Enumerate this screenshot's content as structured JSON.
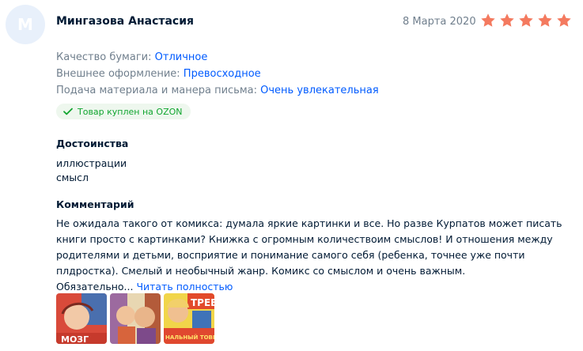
{
  "review": {
    "avatar_letter": "М",
    "author": "Мингазова Анастасия",
    "date": "8 Марта 2020",
    "rating": 5,
    "star_color": "#f47a5f",
    "attributes": [
      {
        "label": "Качество бумаги:",
        "value": "Отличное"
      },
      {
        "label": "Внешнее оформление:",
        "value": "Превосходное"
      },
      {
        "label": "Подача материала и манера письма:",
        "value": "Очень увлекательная"
      }
    ],
    "badge": {
      "icon": "check-icon",
      "text": "Товар куплен на OZON",
      "color": "#10a52f"
    },
    "pros_title": "Достоинства",
    "pros": [
      "иллюстрации",
      "смысл"
    ],
    "comment_title": "Комментарий",
    "comment_text": "Не ожидала такого от комикса: думала яркие картинки и все. Но разве Курпатов может писать книги просто с картинками? Книжка с огромным количествоим смыслов! И отношения между родителями и детьми, восприятие и понимание самого себя (ребенка, точнее уже почти плдростка). Смелый и необычный жанр. Комикс со смыслом и очень важным. Обязательно...",
    "read_more": "Читать полностью",
    "photo_texts": [
      "МОЗГ",
      "ТРЕВ",
      "НАЛЬНЫЙ ТОВЕЦ"
    ]
  }
}
